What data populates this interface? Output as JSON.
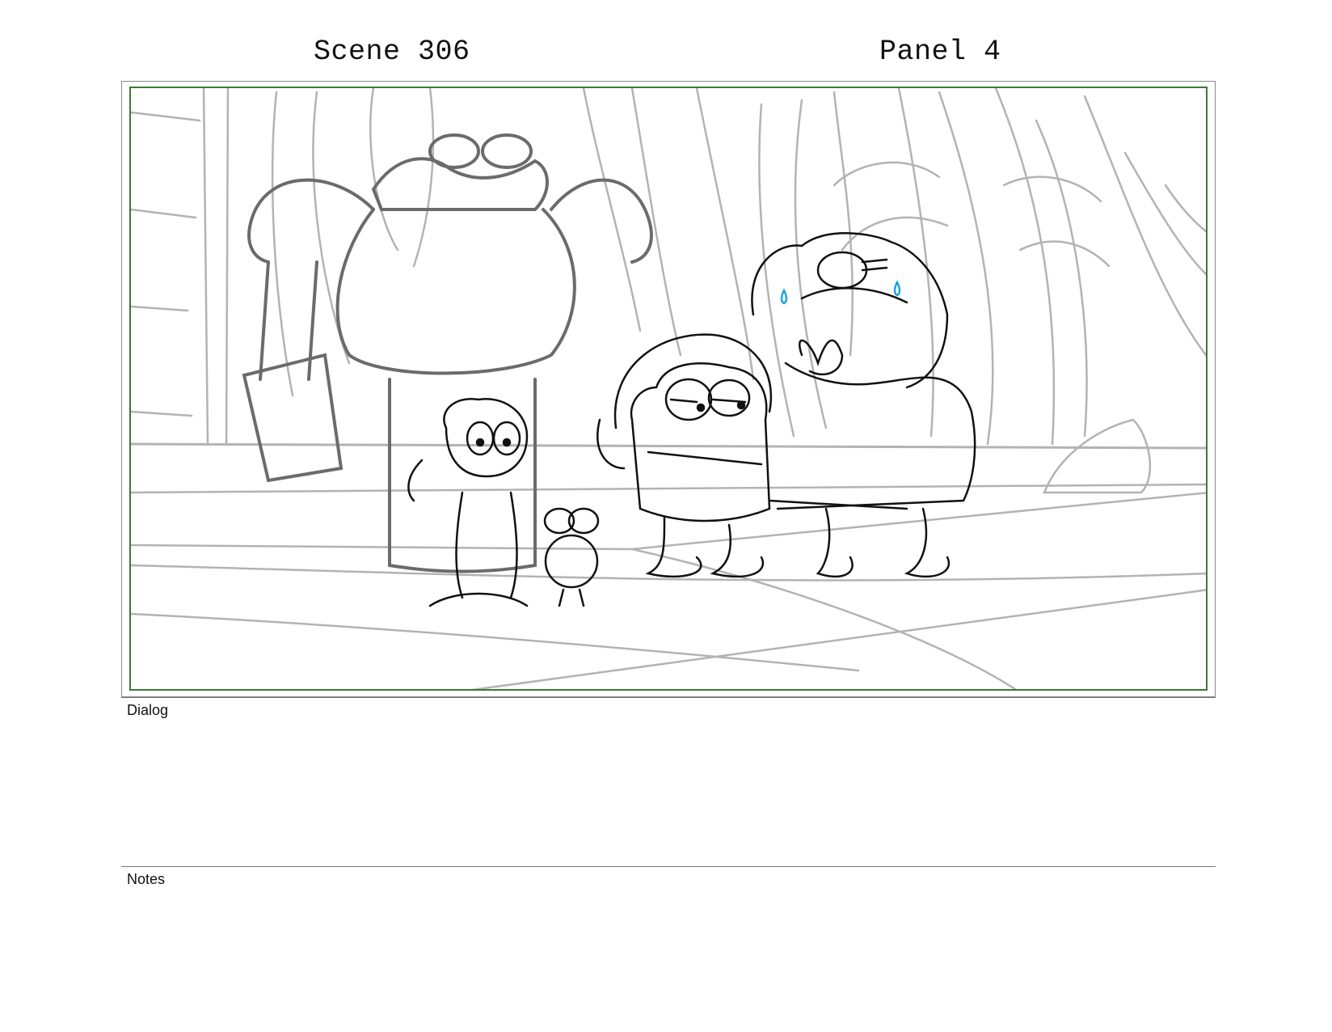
{
  "header": {
    "scene_label": "Scene 306",
    "panel_label": "Panel 4"
  },
  "panel_image": {
    "icon": "storyboard-sketch",
    "colors": {
      "frame_border": "#3a7a35",
      "sketch_line": "#111111",
      "background_line": "#aaaaaa",
      "tear_accent": "#1aa3e0"
    }
  },
  "sections": {
    "dialog_label": "Dialog",
    "dialog_text": "",
    "notes_label": "Notes",
    "notes_text": ""
  }
}
